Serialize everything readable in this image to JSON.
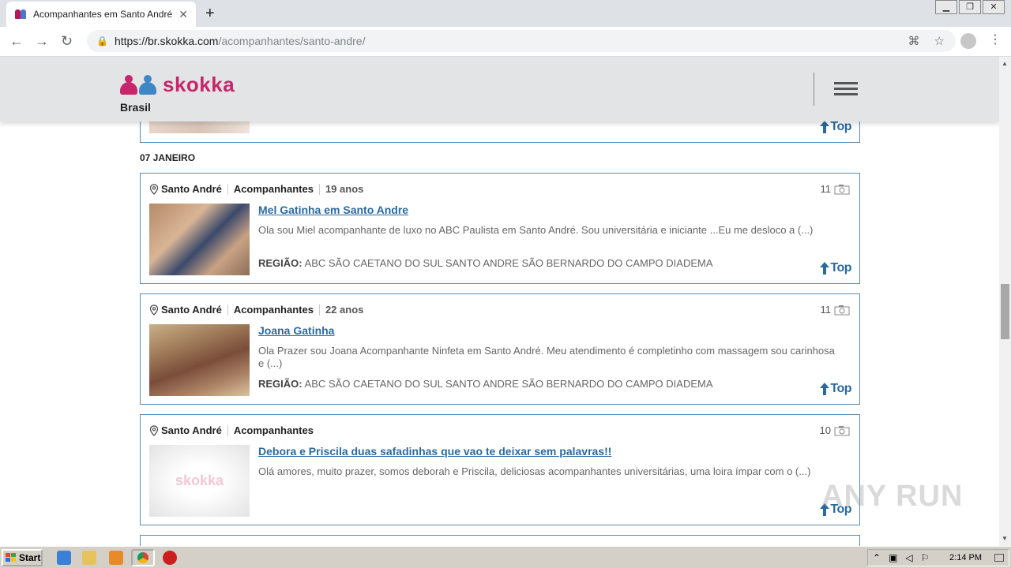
{
  "browser": {
    "tab_title": "Acompanhantes em Santo André e g",
    "tab_close": "✕",
    "new_tab": "+",
    "url_host": "https://br.skokka.com",
    "url_path": "/acompanhantes/santo-andre/",
    "window_buttons": [
      "▁",
      "❐",
      "✕"
    ]
  },
  "site": {
    "logo_text": "skokka",
    "country": "Brasil",
    "logo_colors": {
      "left": "#c7266b",
      "right": "#3f86c7"
    },
    "date_heading": "07 JANEIRO",
    "top_label": "Top"
  },
  "listings": [
    {
      "city": "Santo André",
      "category": "Acompanhantes",
      "age": "19 anos",
      "photo_count": "11",
      "title": "Mel Gatinha em Santo Andre",
      "description": "Ola sou Miel acompanhante de luxo no ABC Paulista em Santo André. Sou universitária e iniciante ...Eu me desloco a (...)",
      "region_label": "REGIÃO:",
      "region": "ABC SÃO CAETANO DO SUL SANTO ANDRE SÃO BERNARDO DO CAMPO DIADEMA"
    },
    {
      "city": "Santo André",
      "category": "Acompanhantes",
      "age": "22 anos",
      "photo_count": "11",
      "title": "Joana Gatinha",
      "description": "Ola Prazer sou Joana Acompanhante Ninfeta em Santo André. Meu atendimento é completinho com massagem sou carinhosa e (...)",
      "region_label": "REGIÃO:",
      "region": "ABC SÃO CAETANO DO SUL SANTO ANDRE SÃO BERNARDO DO CAMPO DIADEMA"
    },
    {
      "city": "Santo André",
      "category": "Acompanhantes",
      "photo_count": "10",
      "title": "Debora e Priscila duas safadinhas que vao te deixar sem palavras!!",
      "description": "Olá amores, muito prazer, somos deborah e Priscila, deliciosas acompanhantes universitárias, uma loira ímpar com o (...)",
      "placeholder_logo": "skokka"
    }
  ],
  "taskbar": {
    "start_label": "Start",
    "clock": "2:14 PM"
  },
  "watermark": "ANY RUN"
}
